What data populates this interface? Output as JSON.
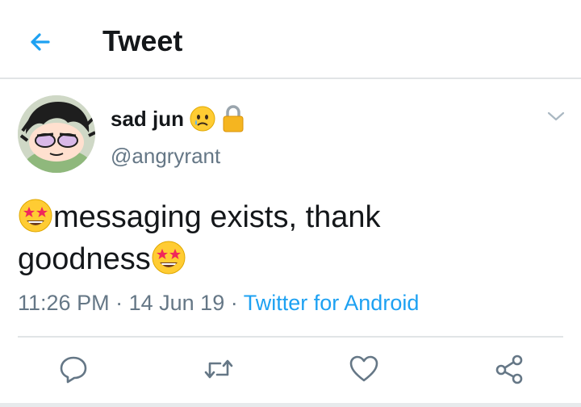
{
  "header": {
    "title": "Tweet",
    "back_icon": "arrow-left-icon"
  },
  "tweet": {
    "author": {
      "display_name": "sad jun",
      "handle": "@angryrant",
      "name_emoji": "sad-face-emoji-icon",
      "lock_icon": "lock-icon"
    },
    "text_line1": "messaging exists, thank",
    "text_line2": "goodness",
    "text_emoji": "star-struck-emoji-icon",
    "time": "11:26 PM",
    "date": "14 Jun 19",
    "separator": "·",
    "source": "Twitter for Android"
  },
  "actions": {
    "reply": "reply-icon",
    "retweet": "retweet-icon",
    "like": "heart-icon",
    "share": "share-icon"
  },
  "colors": {
    "accent": "#1da1f2",
    "secondary_text": "#657786",
    "primary_text": "#14171a",
    "divider": "#e1e4e6"
  }
}
